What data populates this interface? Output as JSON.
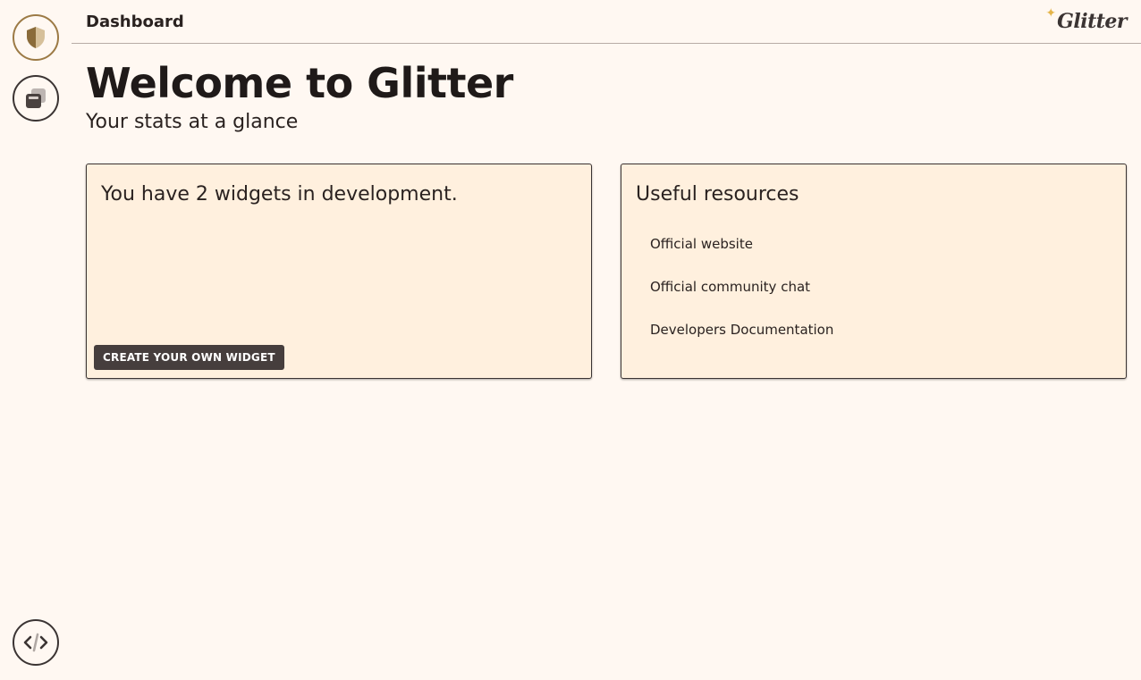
{
  "topbar": {
    "title": "Dashboard",
    "logo_text": "Glitter",
    "logo_star": "✦"
  },
  "sidebar": {
    "items": [
      {
        "icon": "shield-icon",
        "active": true
      },
      {
        "icon": "widgets-icon",
        "active": false
      },
      {
        "icon": "code-icon",
        "active": false
      }
    ]
  },
  "main": {
    "heading": "Welcome to Glitter",
    "subheading": "Your stats at a glance"
  },
  "widgets_card": {
    "text": "You have 2 widgets in development.",
    "button_label": "CREATE YOUR OWN WIDGET"
  },
  "resources_card": {
    "title": "Useful resources",
    "links": [
      {
        "label": "Official website"
      },
      {
        "label": "Official community chat"
      },
      {
        "label": "Developers Documentation"
      }
    ]
  },
  "colors": {
    "background": "#fff8f2",
    "card": "#fff0de",
    "accent": "#9c7a45",
    "button": "#463e3d",
    "star": "#e5b54a"
  }
}
